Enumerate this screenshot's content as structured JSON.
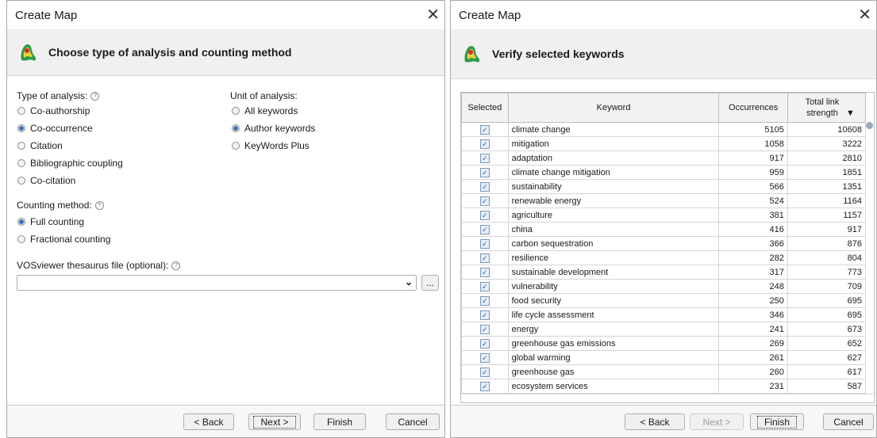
{
  "left": {
    "title": "Create Map",
    "heading": "Choose type of analysis and counting method",
    "type_label": "Type of analysis:",
    "type_options": [
      {
        "label": "Co-authorship",
        "selected": false
      },
      {
        "label": "Co-occurrence",
        "selected": true
      },
      {
        "label": "Citation",
        "selected": false
      },
      {
        "label": "Bibliographic coupling",
        "selected": false
      },
      {
        "label": "Co-citation",
        "selected": false
      }
    ],
    "unit_label": "Unit of analysis:",
    "unit_options": [
      {
        "label": "All keywords",
        "selected": false
      },
      {
        "label": "Author keywords",
        "selected": true
      },
      {
        "label": "KeyWords Plus",
        "selected": false
      }
    ],
    "counting_label": "Counting method:",
    "counting_options": [
      {
        "label": "Full counting",
        "selected": true
      },
      {
        "label": "Fractional counting",
        "selected": false
      }
    ],
    "thesaurus_label": "VOSviewer thesaurus file (optional):",
    "thesaurus_value": "",
    "browse_label": "...",
    "buttons": {
      "back": "< Back",
      "next": "Next >",
      "finish": "Finish",
      "cancel": "Cancel"
    }
  },
  "right": {
    "title": "Create Map",
    "heading": "Verify selected keywords",
    "columns": {
      "selected": "Selected",
      "keyword": "Keyword",
      "occurrences": "Occurrences",
      "tls": "Total link strength"
    },
    "rows": [
      {
        "keyword": "climate change",
        "occurrences": "5105",
        "tls": "10608"
      },
      {
        "keyword": "mitigation",
        "occurrences": "1058",
        "tls": "3222"
      },
      {
        "keyword": "adaptation",
        "occurrences": "917",
        "tls": "2810"
      },
      {
        "keyword": "climate change mitigation",
        "occurrences": "959",
        "tls": "1851"
      },
      {
        "keyword": "sustainability",
        "occurrences": "566",
        "tls": "1351"
      },
      {
        "keyword": "renewable energy",
        "occurrences": "524",
        "tls": "1164"
      },
      {
        "keyword": "agriculture",
        "occurrences": "381",
        "tls": "1157"
      },
      {
        "keyword": "china",
        "occurrences": "416",
        "tls": "917"
      },
      {
        "keyword": "carbon sequestration",
        "occurrences": "366",
        "tls": "876"
      },
      {
        "keyword": "resilience",
        "occurrences": "282",
        "tls": "804"
      },
      {
        "keyword": "sustainable development",
        "occurrences": "317",
        "tls": "773"
      },
      {
        "keyword": "vulnerability",
        "occurrences": "248",
        "tls": "709"
      },
      {
        "keyword": "food security",
        "occurrences": "250",
        "tls": "695"
      },
      {
        "keyword": "life cycle assessment",
        "occurrences": "346",
        "tls": "695"
      },
      {
        "keyword": "energy",
        "occurrences": "241",
        "tls": "673"
      },
      {
        "keyword": "greenhouse gas emissions",
        "occurrences": "269",
        "tls": "652"
      },
      {
        "keyword": "global warming",
        "occurrences": "261",
        "tls": "627"
      },
      {
        "keyword": "greenhouse gas",
        "occurrences": "260",
        "tls": "617"
      },
      {
        "keyword": "ecosystem services",
        "occurrences": "231",
        "tls": "587"
      }
    ],
    "buttons": {
      "back": "< Back",
      "next": "Next >",
      "finish": "Finish",
      "cancel": "Cancel"
    }
  }
}
